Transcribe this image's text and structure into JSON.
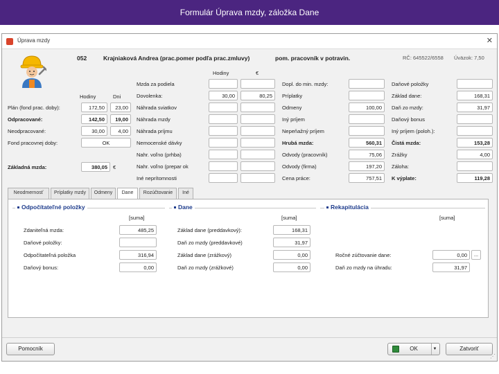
{
  "slide": {
    "title": "Formulár Úprava mzdy, záložka Dane"
  },
  "window": {
    "title": "Úprava mzdy",
    "close": "✕"
  },
  "employee": {
    "id": "052",
    "name": "Krajniaková Andrea (prac.pomer podľa prac.zmluvy)",
    "position": "pom. pracovník v potravin.",
    "rc": "RČ: 645522/6558",
    "uvazok": "Úväzok: 7,50"
  },
  "left_block": {
    "header_hodiny": "Hodiny",
    "header_dni": "Dni",
    "rows": [
      {
        "label": "Plán (fond prac. doby):",
        "hodiny": "172,50",
        "dni": "23,00",
        "bold": false
      },
      {
        "label": "Odpracované:",
        "hodiny": "142,50",
        "dni": "19,00",
        "bold": true
      },
      {
        "label": "Neodpracované:",
        "hodiny": "30,00",
        "dni": "4,00",
        "bold": false
      }
    ],
    "fond_label": "Fond pracovnej doby:",
    "fond_value": "OK",
    "zakladna_label": "Základná mzda:",
    "zakladna_value": "380,05",
    "zakladna_unit": "€"
  },
  "mid_block": {
    "header_hodiny": "Hodiny",
    "header_euro": "€",
    "rows": [
      {
        "label": "Mzda za podiela",
        "hodiny": "",
        "suma": ""
      },
      {
        "label": "Dovolenka:",
        "hodiny": "30,00",
        "suma": "80,25"
      },
      {
        "label": "Náhrada sviatkov",
        "hodiny": "",
        "suma": ""
      },
      {
        "label": "Náhrada mzdy",
        "hodiny": "",
        "suma": ""
      },
      {
        "label": "Náhrada príjmu",
        "hodiny": "",
        "suma": ""
      },
      {
        "label": "Nemocenské dávky",
        "hodiny": "",
        "suma": ""
      },
      {
        "label": "Nahr. voľno (prhba)",
        "hodiny": "",
        "suma": ""
      },
      {
        "label": "Nahr. voľno (prepar ok",
        "hodiny": "",
        "suma": ""
      },
      {
        "label": "Iné neprítomnosti",
        "hodiny": "",
        "suma": ""
      }
    ]
  },
  "right_block_a": {
    "rows": [
      {
        "label": "Dopl. do min. mzdy:",
        "value": "",
        "bold": false
      },
      {
        "label": "Príplatky",
        "value": "",
        "bold": false
      },
      {
        "label": "Odmeny",
        "value": "100,00",
        "bold": false
      },
      {
        "label": "Iný príjem",
        "value": "",
        "bold": false
      },
      {
        "label": "Nepeňažný príjem",
        "value": "",
        "bold": false
      },
      {
        "label": "Hrubá mzda:",
        "value": "560,31",
        "bold": true
      },
      {
        "label": "Odvody (pracovník)",
        "value": "75,06",
        "bold": false
      },
      {
        "label": "Odvody (firma)",
        "value": "197,20",
        "bold": false
      },
      {
        "label": "Cena práce:",
        "value": "757,51",
        "bold": false
      }
    ]
  },
  "right_block_b": {
    "rows": [
      {
        "label": "Daňové položky",
        "value": "",
        "bold": false
      },
      {
        "label": "Základ dane:",
        "value": "168,31",
        "bold": false
      },
      {
        "label": "Daň zo mzdy:",
        "value": "31,97",
        "bold": false
      },
      {
        "label": "Daňový bonus",
        "value": "",
        "bold": false
      },
      {
        "label": "Iný príjem (poloh.):",
        "value": "",
        "bold": false
      },
      {
        "label": "Čistá mzda:",
        "value": "153,28",
        "bold": true
      },
      {
        "label": "Zrážky",
        "value": "4,00",
        "bold": false
      },
      {
        "label": "Záloha:",
        "value": "",
        "bold": false
      },
      {
        "label": "K výplate:",
        "value": "119,28",
        "bold": true
      }
    ]
  },
  "tabs": [
    {
      "label": "Neodmernosť",
      "active": false
    },
    {
      "label": "Príplatky mzdy",
      "active": false
    },
    {
      "label": "Odmeny",
      "active": false
    },
    {
      "label": "Dane",
      "active": true
    },
    {
      "label": "Rozúčtovanie",
      "active": false
    },
    {
      "label": "Iné",
      "active": false
    }
  ],
  "dane_tab": {
    "group1": {
      "title": "Odpočítateľné položky",
      "col_header": "[suma]",
      "rows": [
        {
          "label": "Zdaniteľná mzda:",
          "value": "485,25"
        },
        {
          "label": "Daňové položky:",
          "value": ""
        },
        {
          "label": "Odpočítateľná položka",
          "value": "316,94"
        },
        {
          "label": "Daňový bonus:",
          "value": "0,00"
        }
      ]
    },
    "group2": {
      "title": "Dane",
      "col_header": "[suma]",
      "rows": [
        {
          "label": "Základ dane (preddavkový):",
          "value": "168,31"
        },
        {
          "label": "Daň zo mzdy (preddavkové)",
          "value": "31,97"
        },
        {
          "label": "Základ dane (zrážkový)",
          "value": "0,00"
        },
        {
          "label": "Daň zo mzdy (zrážkové)",
          "value": "0,00"
        }
      ]
    },
    "group3": {
      "title": "Rekapitulácia",
      "col_header": "[suma]",
      "rows": [
        {
          "label": "Ročné zúčtovanie dane:",
          "value": "0,00"
        },
        {
          "label": "Daň zo mzdy na úhradu:",
          "value": "31,97"
        }
      ],
      "dots_button": "..."
    }
  },
  "footer": {
    "help_label": "Pomocník",
    "ok_label": "OK",
    "close_label": "Zatvoriť"
  },
  "colors": {
    "header_bg": "#4b2580",
    "group_title": "#1e3c8c"
  }
}
